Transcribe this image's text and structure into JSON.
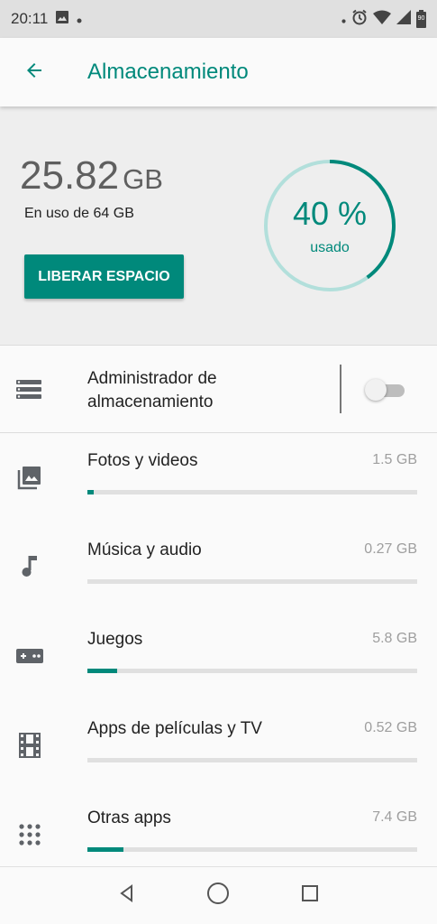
{
  "status_bar": {
    "time": "20:11",
    "battery": "90",
    "icons": [
      "image-notification-icon",
      "dot-icon",
      "alarm-icon",
      "wifi-icon",
      "signal-icon",
      "battery-icon"
    ]
  },
  "app_bar": {
    "title": "Almacenamiento",
    "back_icon": "arrow-back-icon"
  },
  "summary": {
    "used_value": "25.82",
    "used_unit": "GB",
    "used_of": "En uso de 64 GB",
    "free_space_button": "LIBERAR ESPACIO",
    "percent_label": "40 %",
    "percent_caption": "usado",
    "percent_value": 0.4
  },
  "storage_manager": {
    "label": "Administrador de almacenamiento",
    "enabled": false
  },
  "categories": [
    {
      "name": "Fotos y videos",
      "size": "1.5 GB",
      "fraction": 0.02,
      "icon": "photo-library-icon"
    },
    {
      "name": "Música y audio",
      "size": "0.27 GB",
      "fraction": 0.0,
      "icon": "music-note-icon"
    },
    {
      "name": "Juegos",
      "size": "5.8 GB",
      "fraction": 0.09,
      "icon": "gamepad-icon"
    },
    {
      "name": "Apps de películas y TV",
      "size": "0.52 GB",
      "fraction": 0.0,
      "icon": "movie-film-icon"
    },
    {
      "name": "Otras apps",
      "size": "7.4 GB",
      "fraction": 0.11,
      "icon": "apps-grid-icon"
    }
  ],
  "colors": {
    "accent": "#00897b",
    "ring_track": "#b2dfdb"
  }
}
